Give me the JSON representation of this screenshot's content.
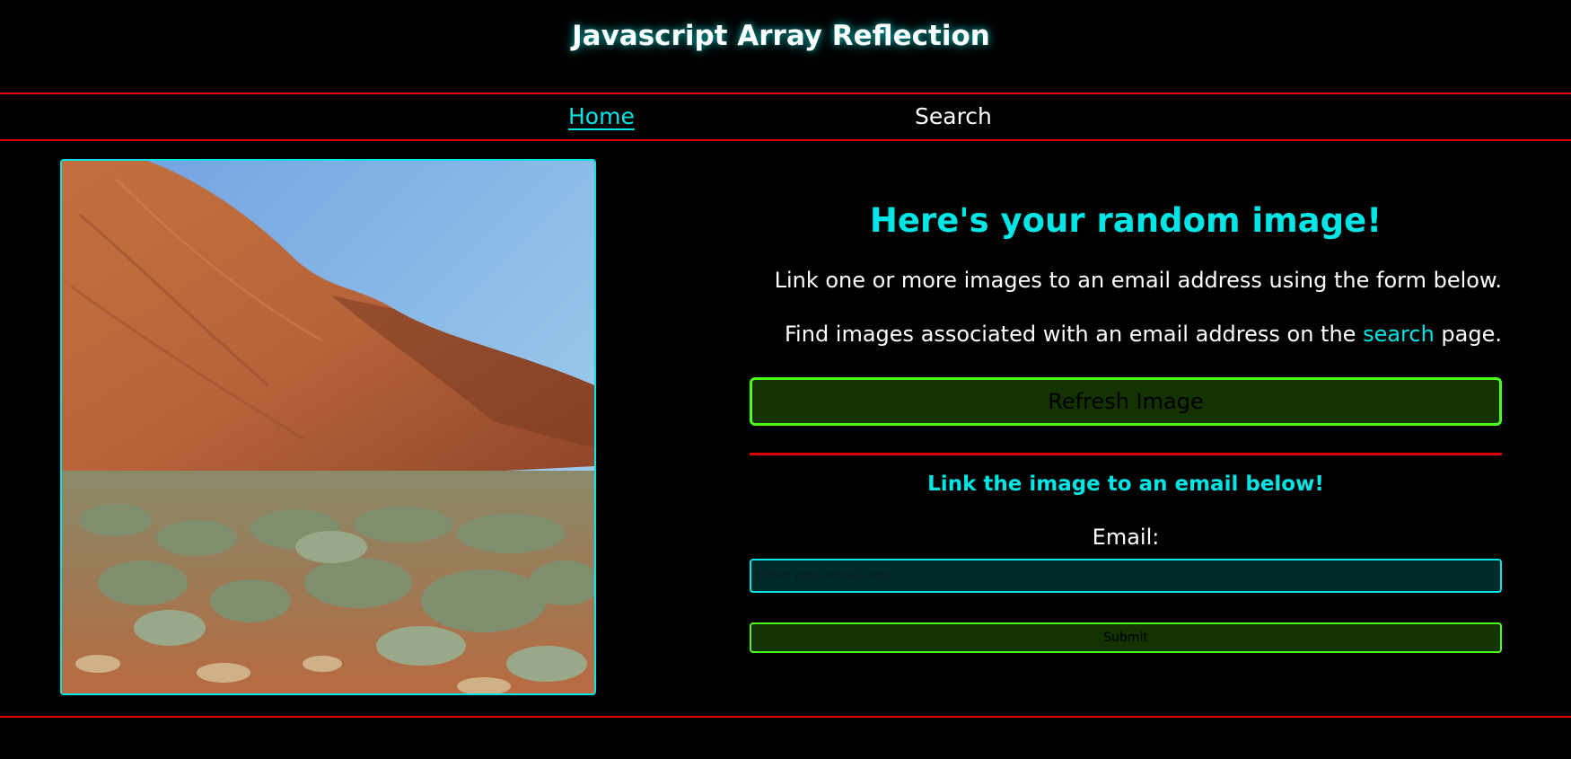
{
  "header": {
    "title": "Javascript Array Reflection"
  },
  "nav": {
    "home_label": "Home",
    "search_label": "Search"
  },
  "main": {
    "image_alt": "Random landscape photo: red rock formation with desert shrubs",
    "heading": "Here's your random image!",
    "paragraph_1": "Link one or more images to an email address using the form below.",
    "paragraph_2_before": "Find images associated with an email address on the ",
    "paragraph_2_link": "search",
    "paragraph_2_after": " page.",
    "refresh_button_label": "Refresh Image",
    "form_heading": "Link the image to an email below!",
    "email_label": "Email:",
    "email_placeholder": "Enter your email here...",
    "email_value": "",
    "submit_label": "Submit"
  },
  "colors": {
    "accent_cyan": "#00e5e5",
    "rule_red": "#e00000",
    "button_border_green": "#4cff1a",
    "button_fill_green": "#133300",
    "background": "#000000"
  }
}
